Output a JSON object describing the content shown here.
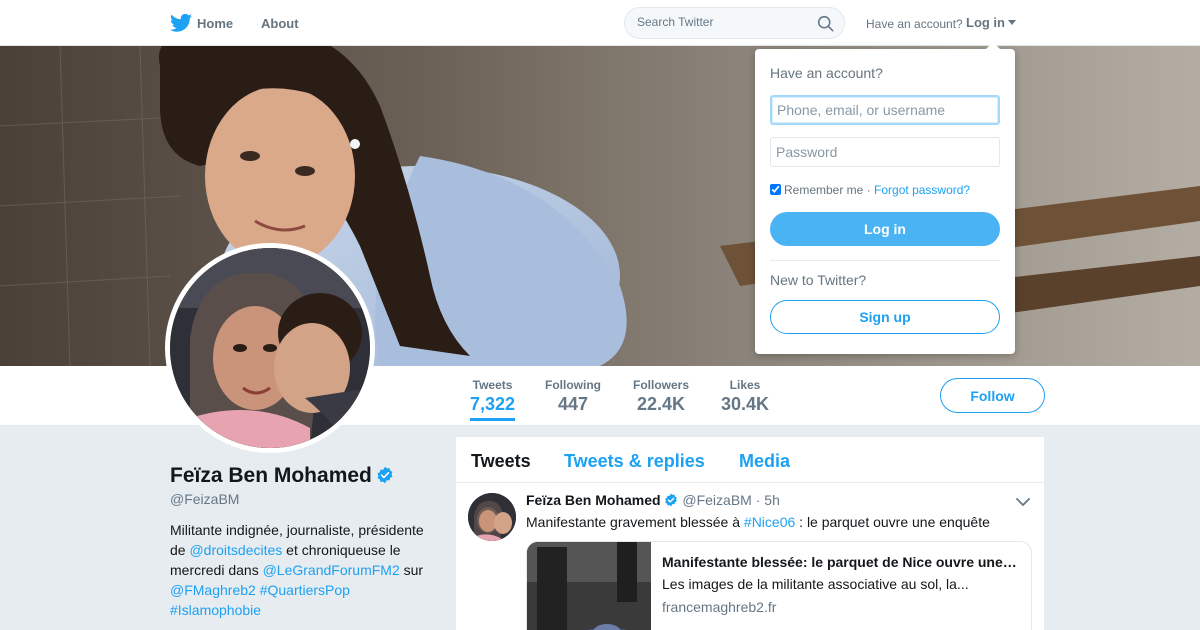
{
  "colors": {
    "accent": "#1da1f2",
    "login_button": "#4ab3f4",
    "page_bg": "#e6ecf0",
    "muted_text": "#657786"
  },
  "topnav": {
    "logo_icon": "twitter-bird-icon",
    "home_label": "Home",
    "about_label": "About",
    "search_placeholder": "Search Twitter",
    "search_icon": "search-icon",
    "have_account_text": "Have an account?",
    "login_label": "Log in"
  },
  "login_dropdown": {
    "heading": "Have an account?",
    "username_placeholder": "Phone, email, or username",
    "password_placeholder": "Password",
    "remember_me_label": "Remember me",
    "separator": "·",
    "forgot_password_label": "Forgot password?",
    "login_button_label": "Log in",
    "new_to_twitter_text": "New to Twitter?",
    "signup_button_label": "Sign up"
  },
  "profile_nav": {
    "stats": [
      {
        "label": "Tweets",
        "value": "7,322",
        "active": true
      },
      {
        "label": "Following",
        "value": "447"
      },
      {
        "label": "Followers",
        "value": "22.4K"
      },
      {
        "label": "Likes",
        "value": "30.4K"
      }
    ],
    "follow_label": "Follow"
  },
  "profile": {
    "name": "Feïza Ben Mohamed",
    "verified_icon": "verified-badge-icon",
    "handle": "@FeizaBM",
    "bio": {
      "text1": "Militante indignée, journaliste, présidente de ",
      "mention1": "@droitsdecites",
      "text2": " et chroniqueuse le mercredi dans ",
      "mention2": "@LeGrandForumFM2",
      "text3": " sur ",
      "mention3": "@FMaghreb2",
      "space": " ",
      "hashtag1": "#QuartiersPop",
      "hashtag2": "#Islamophobie"
    }
  },
  "timeline": {
    "tabs": [
      "Tweets",
      "Tweets & replies",
      "Media"
    ],
    "tweet": {
      "name": "Feïza Ben Mohamed",
      "handle": "@FeizaBM",
      "separator": "·",
      "time": "5h",
      "text_before": "Manifestante gravement blessée à ",
      "hashtag": "#Nice06",
      "text_after": " : le parquet ouvre une enquête",
      "card": {
        "title": "Manifestante blessée: le parquet de Nice ouvre une…",
        "description": "Les images de la militante associative au sol, la...",
        "domain": "francemaghreb2.fr"
      }
    }
  }
}
